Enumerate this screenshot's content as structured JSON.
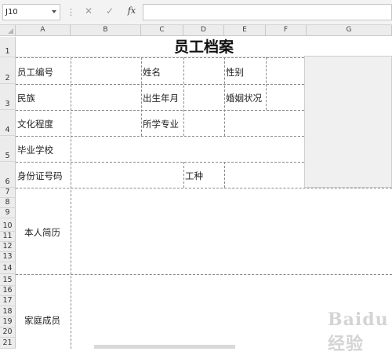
{
  "formula_bar": {
    "name_box": "J10",
    "dots": "⋮",
    "cancel_icon": "✕",
    "enter_icon": "✓",
    "fx_label": "fx",
    "formula": ""
  },
  "columns": [
    "A",
    "B",
    "C",
    "D",
    "E",
    "F",
    "G"
  ],
  "rows": [
    "1",
    "2",
    "3",
    "4",
    "5",
    "6",
    "7",
    "8",
    "9",
    "10",
    "11",
    "12",
    "13",
    "14",
    "15",
    "16",
    "17",
    "18",
    "19",
    "20",
    "21"
  ],
  "active_cell": "J10",
  "sheet": {
    "title": "员工档案",
    "labels": {
      "employee_id": "员工编号",
      "name": "姓名",
      "gender": "性别",
      "ethnicity": "民族",
      "birth_date": "出生年月",
      "marital_status": "婚姻状况",
      "education": "文化程度",
      "major": "所学专业",
      "school": "毕业学校",
      "id_number": "身份证号码",
      "job_type": "工种",
      "resume": "本人简历",
      "family": "家庭成员"
    }
  },
  "watermark": "Baidu经验"
}
